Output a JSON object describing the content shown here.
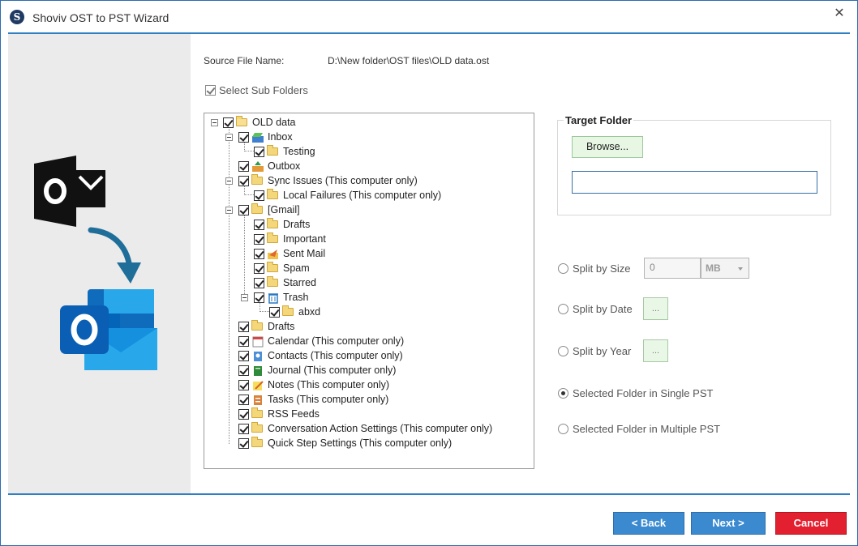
{
  "window": {
    "title": "Shoviv OST to PST Wizard",
    "logo_letter": "S",
    "close_glyph": "✕"
  },
  "source": {
    "label": "Source File Name:",
    "value": "D:\\New folder\\OST files\\OLD data.ost"
  },
  "subfolders": {
    "label": "Select Sub Folders",
    "checked": true
  },
  "tree": [
    {
      "label": "OLD data",
      "icon": "mailbox-icon"
    },
    {
      "label": "Inbox",
      "icon": "inbox-icon"
    },
    {
      "label": "Testing",
      "icon": "folder-icon"
    },
    {
      "label": "Outbox",
      "icon": "outbox-icon"
    },
    {
      "label": "Sync Issues (This computer only)",
      "icon": "folder-icon"
    },
    {
      "label": "Local Failures (This computer only)",
      "icon": "folder-icon"
    },
    {
      "label": "[Gmail]",
      "icon": "folder-icon"
    },
    {
      "label": "Drafts",
      "icon": "folder-icon"
    },
    {
      "label": "Important",
      "icon": "folder-icon"
    },
    {
      "label": "Sent Mail",
      "icon": "sent-icon"
    },
    {
      "label": "Spam",
      "icon": "folder-icon"
    },
    {
      "label": "Starred",
      "icon": "folder-icon"
    },
    {
      "label": "Trash",
      "icon": "trash-icon"
    },
    {
      "label": "abxd",
      "icon": "folder-icon"
    },
    {
      "label": "Drafts",
      "icon": "folder-icon"
    },
    {
      "label": "Calendar (This computer only)",
      "icon": "calendar-icon"
    },
    {
      "label": "Contacts (This computer only)",
      "icon": "contacts-icon"
    },
    {
      "label": "Journal (This computer only)",
      "icon": "journal-icon"
    },
    {
      "label": "Notes (This computer only)",
      "icon": "notes-icon"
    },
    {
      "label": "Tasks (This computer only)",
      "icon": "tasks-icon"
    },
    {
      "label": "RSS Feeds",
      "icon": "folder-icon"
    },
    {
      "label": "Conversation Action Settings (This computer only)",
      "icon": "folder-icon"
    },
    {
      "label": "Quick Step Settings (This computer only)",
      "icon": "folder-icon"
    }
  ],
  "target": {
    "label": "Target Folder",
    "browse_label": "Browse...",
    "path_value": ""
  },
  "options": {
    "split_size": {
      "label": "Split by Size",
      "value": "0",
      "unit": "MB",
      "selected": false
    },
    "split_date": {
      "label": "Split by Date",
      "button": "...",
      "selected": false
    },
    "split_year": {
      "label": "Split by Year",
      "button": "...",
      "selected": false
    },
    "single_pst": {
      "label": "Selected Folder in Single PST",
      "selected": true
    },
    "multiple_pst": {
      "label": "Selected Folder in Multiple PST",
      "selected": false
    }
  },
  "nav": {
    "back": "< Back",
    "next": "Next >",
    "cancel": "Cancel"
  },
  "colors": {
    "accent": "#3b8ad0",
    "cancel": "#e3202f",
    "rule": "#2f7fc1",
    "sidepanel": "#ebebeb"
  }
}
